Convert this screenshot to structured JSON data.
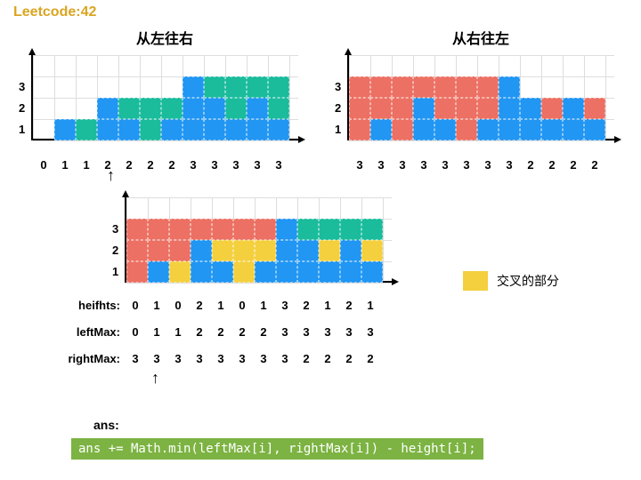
{
  "header": "Leetcode:42",
  "chart_data": [
    {
      "type": "bar",
      "title": "从左往右",
      "ylabels": [
        "1",
        "2",
        "3"
      ],
      "xlabels": [
        "0",
        "1",
        "1",
        "2",
        "2",
        "2",
        "2",
        "3",
        "3",
        "3",
        "3",
        "3"
      ],
      "blue": [
        0,
        1,
        0,
        2,
        1,
        0,
        1,
        3,
        2,
        1,
        2,
        1
      ],
      "overlay": [
        0,
        1,
        1,
        2,
        2,
        2,
        2,
        3,
        3,
        3,
        3,
        3
      ],
      "overlay_color": "teal"
    },
    {
      "type": "bar",
      "title": "从右往左",
      "ylabels": [
        "1",
        "2",
        "3"
      ],
      "xlabels": [
        "3",
        "3",
        "3",
        "3",
        "3",
        "3",
        "3",
        "3",
        "2",
        "2",
        "2",
        "2"
      ],
      "blue": [
        0,
        1,
        0,
        2,
        1,
        0,
        1,
        3,
        2,
        1,
        2,
        1
      ],
      "overlay": [
        3,
        3,
        3,
        3,
        3,
        3,
        3,
        3,
        2,
        2,
        2,
        2
      ],
      "overlay_color": "pink"
    },
    {
      "type": "bar",
      "title": "",
      "ylabels": [
        "1",
        "2",
        "3"
      ],
      "blue": [
        0,
        1,
        0,
        2,
        1,
        0,
        1,
        3,
        2,
        1,
        2,
        1
      ],
      "leftMax": [
        0,
        1,
        1,
        2,
        2,
        2,
        2,
        3,
        3,
        3,
        3,
        3
      ],
      "rightMax": [
        3,
        3,
        3,
        3,
        3,
        3,
        3,
        3,
        2,
        2,
        2,
        2
      ]
    }
  ],
  "rows": {
    "heights_label": "heifhts:",
    "leftmax_label": "leftMax:",
    "rightmax_label": "rightMax:",
    "heights": [
      "0",
      "1",
      "0",
      "2",
      "1",
      "0",
      "1",
      "3",
      "2",
      "1",
      "2",
      "1"
    ],
    "leftmax": [
      "0",
      "1",
      "1",
      "2",
      "2",
      "2",
      "2",
      "3",
      "3",
      "3",
      "3",
      "3"
    ],
    "rightmax": [
      "3",
      "3",
      "3",
      "3",
      "3",
      "3",
      "3",
      "3",
      "2",
      "2",
      "2",
      "2"
    ]
  },
  "legend": {
    "label": "交叉的部分"
  },
  "ans_label": "ans:",
  "formula": "ans += Math.min(leftMax[i], rightMax[i]) - height[i];"
}
